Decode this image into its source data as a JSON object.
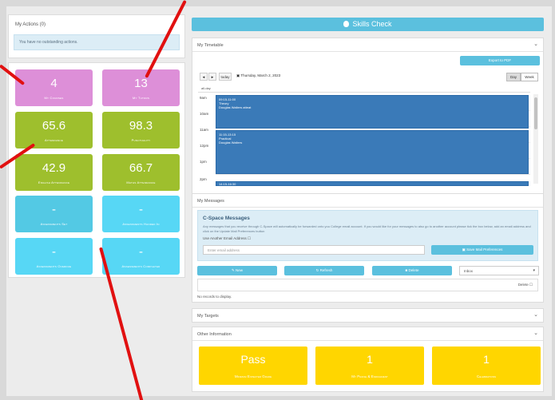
{
  "actions": {
    "title": "My Actions (0)",
    "message": "You have no outstanding actions."
  },
  "tiles": [
    {
      "value": "4",
      "label": "My Courses",
      "color": "#dd8fd8"
    },
    {
      "value": "13",
      "label": "My Tutors",
      "color": "#dd8fd8"
    },
    {
      "value": "65.6",
      "label": "Attendance",
      "color": "#9ebf2d"
    },
    {
      "value": "98.3",
      "label": "Punctuality",
      "color": "#9ebf2d"
    },
    {
      "value": "42.9",
      "label": "English Attendance",
      "color": "#9ebf2d"
    },
    {
      "value": "66.7",
      "label": "Maths Attendance",
      "color": "#9ebf2d"
    },
    {
      "value": "-",
      "label": "Assessments Set",
      "color": "#53c9e4"
    },
    {
      "value": "-",
      "label": "Assessments Handed In",
      "color": "#57d7f5"
    },
    {
      "value": "-",
      "label": "Assessments Overdue",
      "color": "#57d7f5"
    },
    {
      "value": "-",
      "label": "Assessments Completed",
      "color": "#57d7f5"
    }
  ],
  "skills_check": {
    "label": "Skills Check",
    "icon": "apple-icon"
  },
  "timetable": {
    "title": "My Timetable",
    "export_label": "Export to PDF",
    "prev": "◄",
    "next": "►",
    "today": "today",
    "date": "Thursday, March 2, 2023",
    "view_day": "Day",
    "view_week": "Week",
    "all_day": "all-day",
    "hours": [
      "9am",
      "10am",
      "11am",
      "12pm",
      "1pm",
      "2pm"
    ],
    "events": [
      {
        "time": "09:15-11:00",
        "title": "Theory",
        "tutor": "Douglas Walters atteat"
      },
      {
        "time": "11:15-13:15",
        "title": "Practical",
        "tutor": "Douglas Walters"
      },
      {
        "time": "14:15-16:30",
        "title": "",
        "tutor": ""
      }
    ]
  },
  "messages": {
    "title": "My Messages",
    "box_title": "C-Space Messages",
    "description": "Any messages that you receive through C-Space will automatically be forwarded onto you College email account. If you would like for your messages to also go to another account please tick the box below, add an email address and click on the Update Mail Preferences button",
    "checkbox_label": "Use Another Email Address",
    "email_placeholder": "Enter email address",
    "save_label": "Save Mail Preferences",
    "new_label": "New",
    "refresh_label": "Refresh",
    "delete_label": "Delete",
    "folder": "Inbox",
    "col_delete": "Delete",
    "empty": "No records to display."
  },
  "targets": {
    "title": "My Targets"
  },
  "other": {
    "title": "Other Information",
    "tiles": [
      {
        "value": "Pass",
        "label": "Minimum Expected Grade"
      },
      {
        "value": "1",
        "label": "My Praise & Enrichment"
      },
      {
        "value": "1",
        "label": "Celebrations"
      }
    ]
  }
}
